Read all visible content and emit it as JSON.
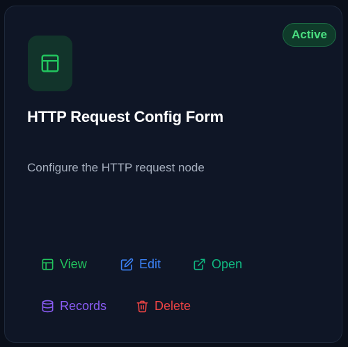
{
  "card": {
    "status": "Active",
    "title": "HTTP Request Config Form",
    "description": "Configure the HTTP request node",
    "icon": "layout-form-icon"
  },
  "actions": {
    "view": {
      "label": "View",
      "icon": "layout-icon"
    },
    "edit": {
      "label": "Edit",
      "icon": "edit-icon"
    },
    "open": {
      "label": "Open",
      "icon": "external-link-icon"
    },
    "records": {
      "label": "Records",
      "icon": "database-icon"
    },
    "delete": {
      "label": "Delete",
      "icon": "trash-icon"
    }
  },
  "colors": {
    "background": "#0a0f1a",
    "card": "#0f1626",
    "status": "#4ade80",
    "view": "#22c55e",
    "edit": "#3b82f6",
    "open": "#10b981",
    "records": "#8b5cf6",
    "delete": "#ef4444"
  }
}
